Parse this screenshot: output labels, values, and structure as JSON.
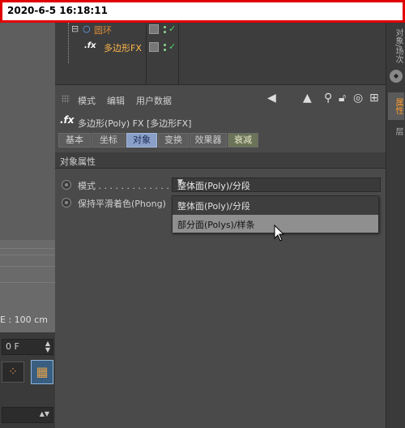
{
  "banner": {
    "timestamp": "2020-6-5 16:18:11"
  },
  "viewport": {
    "scale_label": "E : 100 cm"
  },
  "timeline": {
    "frame_value": "0 F"
  },
  "object_manager": {
    "objects": [
      {
        "name": "圆环",
        "icon": "circle-icon",
        "color": "#d88a3a"
      },
      {
        "name": "多边形FX",
        "icon": "fx-icon",
        "color": "#ffb84a"
      }
    ]
  },
  "side_tabs": [
    "对象/场次",
    "属性",
    "层"
  ],
  "attributes": {
    "menu": [
      "模式",
      "编辑",
      "用户数据"
    ],
    "title": "多边形(Poly) FX [多边形FX]",
    "tabs": [
      "基本",
      "坐标",
      "对象",
      "变换",
      "效果器",
      "衰减"
    ],
    "active_tab": "对象",
    "section_title": "对象属性",
    "properties": [
      {
        "label": "模式 . . . . . . . . . . . . . . .",
        "value": "整体面(Poly)/分段"
      },
      {
        "label": "保持平滑着色(Phong)",
        "value": ""
      }
    ],
    "dropdown_options": [
      "整体面(Poly)/分段",
      "部分面(Polys)/样条"
    ],
    "hover_option": "部分面(Polys)/样条"
  },
  "colors": {
    "active_tab": "#8aa0c8",
    "highlight_tab": "#ff9a2a",
    "check_green": "#4cd96b",
    "banner_border": "#e00000"
  }
}
